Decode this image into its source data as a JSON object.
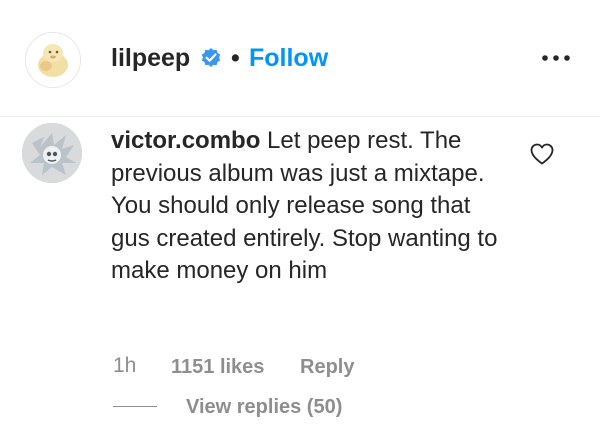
{
  "header": {
    "username": "lilpeep",
    "verified_icon": "verified-badge-icon",
    "separator": "•",
    "follow_label": "Follow",
    "more_icon": "more-options-icon",
    "avatar_icon": "lilpeep-avatar"
  },
  "comment": {
    "avatar_icon": "victor-combo-avatar",
    "username": "victor.combo",
    "text": "Let peep rest. The previous album was just a mixtape. You should only release song that gus created entirely. Stop wanting to make money on him",
    "like_icon": "heart-outline-icon",
    "time": "1h",
    "likes": "1151 likes",
    "reply_label": "Reply",
    "view_replies_label": "View replies (50)"
  },
  "colors": {
    "accent_blue": "#0095f6",
    "text_primary": "#262626",
    "text_secondary": "#8e8e8e",
    "verified_blue": "#3897f0",
    "divider": "#efefef"
  }
}
